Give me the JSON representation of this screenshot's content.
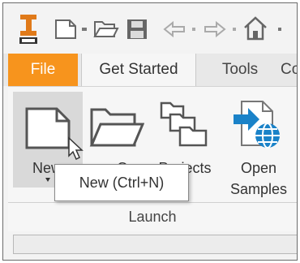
{
  "quick_access": {
    "icons": [
      "app-logo-icon",
      "new-file-icon",
      "dropdown-arrow-icon",
      "open-folder-icon",
      "save-icon",
      "undo-icon",
      "dropdown-arrow-icon",
      "redo-icon",
      "dropdown-arrow-icon",
      "home-icon"
    ]
  },
  "tabs": {
    "file": "File",
    "get_started": "Get Started",
    "tools": "Tools",
    "truncated": "Co"
  },
  "ribbon": {
    "new_label": "New",
    "open_label": "O",
    "projects_label": "Projects",
    "open_samples_line1": "Open",
    "open_samples_line2": "Samples",
    "panel_title": "Launch"
  },
  "tooltip": {
    "text": "New (Ctrl+N)"
  },
  "colors": {
    "file_tab": "#f7941d",
    "accent_blue": "#1a82c8",
    "logo_orange": "#e07a1a"
  }
}
